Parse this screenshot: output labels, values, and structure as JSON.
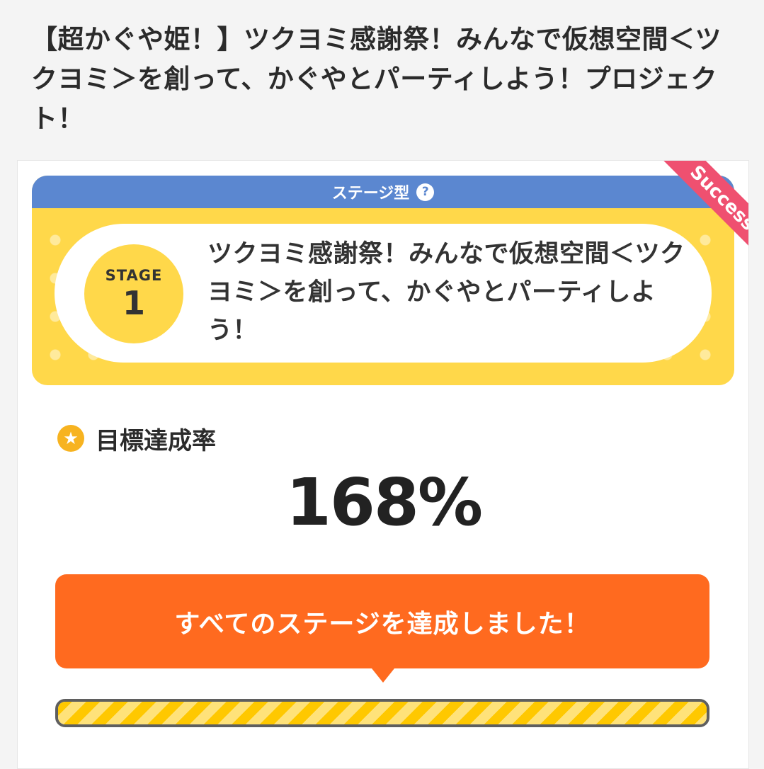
{
  "project": {
    "title": "【超かぐや姫！】ツクヨミ感謝祭！みんなで仮想空間＜ツクヨミ＞を創って、かぐやとパーティしよう！プロジェクト！"
  },
  "stage": {
    "type_label": "ステージ型",
    "help_icon": "?",
    "badge_label": "STAGE",
    "number": "1",
    "title": "ツクヨミ感謝祭！みんなで仮想空間＜ツクヨミ＞を創って、かぐやとパーティしよう！",
    "status_ribbon": "Success"
  },
  "goal": {
    "label": "目標達成率",
    "icon": "star-icon",
    "rate_text": "168%",
    "progress_fraction": 1.0
  },
  "banner": {
    "text": "すべてのステージを達成しました！"
  },
  "colors": {
    "stage_bar": "#5b87d0",
    "stage_bg": "#ffd84a",
    "ribbon": "#ef5070",
    "banner": "#ff6a1f",
    "progress": "#ffc800"
  }
}
